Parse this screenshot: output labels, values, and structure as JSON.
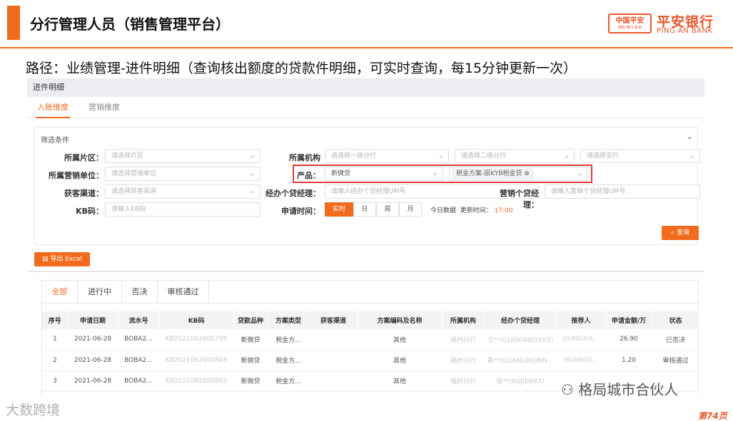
{
  "slide": {
    "title": "分行管理人员（销售管理平台）",
    "path": "路径：业绩管理-进件明细（查询核出额度的贷款件明细，可实时查询，每15分钟更新一次）",
    "page_number": "第74页"
  },
  "logo": {
    "badge_top": "中国平安",
    "badge_bottom": "保险·银行·投资",
    "name_cn": "平安银行",
    "name_en": "PING AN BANK",
    "color": "#e8572a"
  },
  "app": {
    "title": "进件明细",
    "subtabs": [
      "入账维度",
      "营销维度"
    ],
    "filter": {
      "title": "筛选条件",
      "region_label": "所属片区：",
      "region_placeholder": "请选择片区",
      "org_label": "所属机构",
      "org1_placeholder": "请选择一级分行",
      "org2_placeholder": "请选择二级分行",
      "org3_placeholder": "请选择支行",
      "unit_label": "所属营销单位：",
      "unit_placeholder": "请选择营销单位",
      "product_label": "产品：",
      "product_value": "新微贷",
      "plan_tag": "税金方案-原KYB税金贷",
      "channel_label": "获客渠道：",
      "channel_placeholder": "请选择获客渠道",
      "manager_label": "经办个贷经理：",
      "manager_placeholder": "请输入经办个贷经理UM号",
      "sales_label": "营销个贷经理：",
      "sales_placeholder": "请输入营销个贷经理UM号",
      "kb_label": "KB码：",
      "kb_placeholder": "请输入KB码",
      "time_label": "申请时间：",
      "time_options": [
        "实时",
        "日",
        "周",
        "月"
      ],
      "today_text": "今日数据",
      "update_label": "更新时间：",
      "update_time": "17:00",
      "query_button": "查询"
    },
    "export_button": "导出 Excel",
    "result_tabs": [
      "全部",
      "进行中",
      "否决",
      "审核通过"
    ],
    "table": {
      "columns": [
        "序号",
        "申请日期",
        "流水号",
        "KB码",
        "贷款品种",
        "方案类型",
        "获客渠道",
        "方案编码及名称",
        "所属机构",
        "经办个贷经理",
        "推荐人",
        "申请金额/万",
        "状态"
      ],
      "rows": [
        [
          "1",
          "2021-06-28",
          "BOBA2...",
          "KB2021062800799",
          "新微贷",
          "税金方...",
          "",
          "其他",
          "福州分行",
          "王**(GUOXIANGXXX)",
          "DONGXIA...",
          "26.90",
          "已否决"
        ],
        [
          "2",
          "2021-06-28",
          "BOBA2...",
          "KB2021062800849",
          "新微贷",
          "税金方...",
          "",
          "其他",
          "福州分行",
          "黄**(GUANGNGBIN...",
          "HUANG0...",
          "1.20",
          "审核通过"
        ],
        [
          "3",
          "2021-06-28",
          "BOBA2...",
          "KB2021062800862",
          "新微贷",
          "税金方...",
          "",
          "其他",
          "福州分行",
          "徐**(XUJIENXX)",
          "",
          "",
          ""
        ]
      ]
    }
  },
  "watermarks": {
    "left": "大数跨境",
    "right": "格局城市合伙人"
  },
  "colors": {
    "accent": "#f26b1d",
    "highlight_border": "#e23b3b"
  }
}
